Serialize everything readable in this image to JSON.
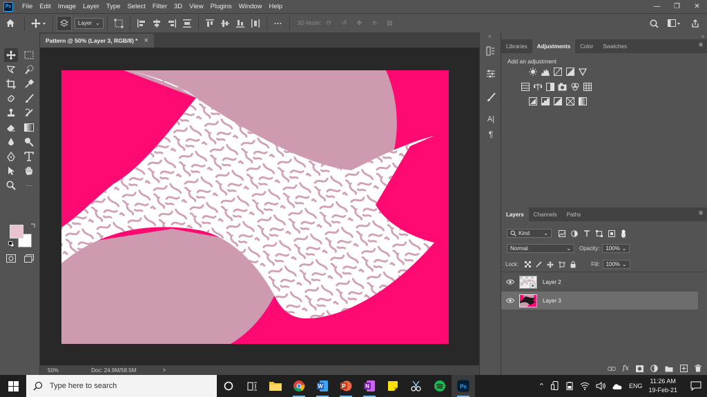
{
  "menubar": {
    "logo": "Ps",
    "items": [
      "File",
      "Edit",
      "Image",
      "Layer",
      "Type",
      "Select",
      "Filter",
      "3D",
      "View",
      "Plugins",
      "Window",
      "Help"
    ]
  },
  "options": {
    "auto_select_target": "Layer",
    "mode_3d": "3D Mode:"
  },
  "document": {
    "tab_title": "Pattern @ 50% (Layer 3, RGB/8) *",
    "close": "×",
    "zoom": "50%",
    "doc_size": "Doc: 24.9M/58.5M",
    "status_arrow": "›"
  },
  "adjustments_panel": {
    "tabs": [
      "Libraries",
      "Adjustments",
      "Color",
      "Swatches"
    ],
    "active_tab": "Adjustments",
    "prompt": "Add an adjustment"
  },
  "layers_panel": {
    "tabs": [
      "Layers",
      "Channels",
      "Paths"
    ],
    "active_tab": "Layers",
    "filter_kind": "Kind",
    "blend_mode": "Normal",
    "opacity_label": "Opacity:",
    "opacity_value": "100%",
    "lock_label": "Lock:",
    "fill_label": "Fill:",
    "fill_value": "100%",
    "layers": [
      {
        "name": "Layer 2",
        "selected": false
      },
      {
        "name": "Layer 3",
        "selected": true
      }
    ]
  },
  "taskbar": {
    "search_placeholder": "Type here to search",
    "language": "ENG",
    "time": "11:26 AM",
    "date": "19-Feb-21"
  },
  "colors": {
    "foreground_swatch": "#e8c3cf",
    "background_swatch": "#ffffff",
    "canvas_magenta": "#ff0a72",
    "canvas_mauve": "#cd9ab0",
    "accent_blue": "#31a8ff"
  }
}
